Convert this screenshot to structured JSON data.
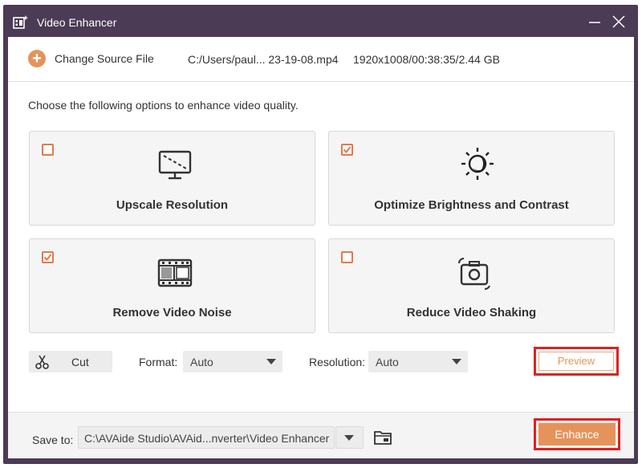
{
  "window": {
    "title": "Video Enhancer"
  },
  "source": {
    "change_label": "Change Source File",
    "file_path": "C:/Users/paul... 23-19-08.mp4",
    "file_info": "1920x1008/00:38:35/2.44 GB"
  },
  "instruction": "Choose the following options to enhance video quality.",
  "options": [
    {
      "label": "Upscale Resolution",
      "icon": "monitor-icon",
      "checked": false
    },
    {
      "label": "Optimize Brightness and Contrast",
      "icon": "brightness-icon",
      "checked": true
    },
    {
      "label": "Remove Video Noise",
      "icon": "film-icon",
      "checked": true
    },
    {
      "label": "Reduce Video Shaking",
      "icon": "camera-stabilize-icon",
      "checked": false
    }
  ],
  "tools": {
    "cut_label": "Cut",
    "format_label": "Format:",
    "format_value": "Auto",
    "resolution_label": "Resolution:",
    "resolution_value": "Auto",
    "preview_label": "Preview"
  },
  "footer": {
    "save_label": "Save to:",
    "save_path": "C:\\AVAide Studio\\AVAid...nverter\\Video Enhancer",
    "enhance_label": "Enhance"
  },
  "colors": {
    "titlebar": "#4b3b55",
    "accent": "#e5935a",
    "highlight": "#e02020"
  }
}
